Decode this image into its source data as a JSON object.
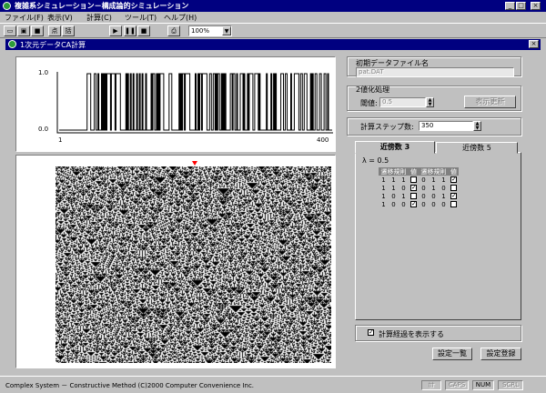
{
  "app": {
    "title": "複雑系シミュレーション－構成論的シミュレーション",
    "min_glyph": "_",
    "max_glyph": "□",
    "close_glyph": "×"
  },
  "menu": [
    "ファイル(F)",
    "表示(V)",
    "計算(C)",
    "ツール(T)",
    "ヘルプ(H)"
  ],
  "toolbar": {
    "buttons": [
      {
        "name": "new-file-icon",
        "glyph": "▭"
      },
      {
        "name": "open-file-icon",
        "glyph": "▣"
      },
      {
        "name": "save-icon",
        "glyph": "■"
      },
      {
        "name": "point-button",
        "glyph": "点"
      },
      {
        "name": "batch-button",
        "glyph": "括"
      },
      {
        "name": "play-icon",
        "glyph": "▶"
      },
      {
        "name": "pause-icon",
        "glyph": "❚❚"
      },
      {
        "name": "stop-icon",
        "glyph": "■"
      },
      {
        "name": "print-icon",
        "glyph": "⎙"
      }
    ],
    "zoom": "100%"
  },
  "child": {
    "title": "1次元データCA計算",
    "close_glyph": "×"
  },
  "graph": {
    "y_top": "1.0",
    "y_bottom": "0.0",
    "x_left": "1",
    "x_right": "400"
  },
  "right": {
    "initial_file_label": "初期データファイル名",
    "initial_file_value": "pat.DAT",
    "binarize_label": "2値化処理",
    "threshold_label": "閾値:",
    "threshold_value": "0.5",
    "show_update_button": "表示更新",
    "steps_label": "計算ステップ数:",
    "steps_value": "350",
    "tabs": [
      "近傍数 3",
      "近傍数 5"
    ],
    "lambda_label": "λ = 0.5",
    "rule_headers": [
      "遷移規則",
      "値",
      "遷移規則",
      "値"
    ],
    "rules_left": [
      {
        "bits": [
          "1",
          "1",
          "1"
        ],
        "checked": false
      },
      {
        "bits": [
          "1",
          "1",
          "0"
        ],
        "checked": true
      },
      {
        "bits": [
          "1",
          "0",
          "1"
        ],
        "checked": false
      },
      {
        "bits": [
          "1",
          "0",
          "0"
        ],
        "checked": true
      }
    ],
    "rules_right": [
      {
        "bits": [
          "0",
          "1",
          "1"
        ],
        "checked": true
      },
      {
        "bits": [
          "0",
          "1",
          "0"
        ],
        "checked": false
      },
      {
        "bits": [
          "0",
          "0",
          "1"
        ],
        "checked": true
      },
      {
        "bits": [
          "0",
          "0",
          "0"
        ],
        "checked": false
      }
    ],
    "show_progress_label": "計算経過を表示する",
    "show_progress_checked": true,
    "list_button": "設定一覧",
    "register_button": "設定登録"
  },
  "status": {
    "text": "Complex System － Constructive Method  (C)2000  Computer Convenience Inc.",
    "indicators": [
      "ｶﾅ",
      "CAPS",
      "NUM",
      "SCRL"
    ],
    "active_indicator": "NUM"
  }
}
